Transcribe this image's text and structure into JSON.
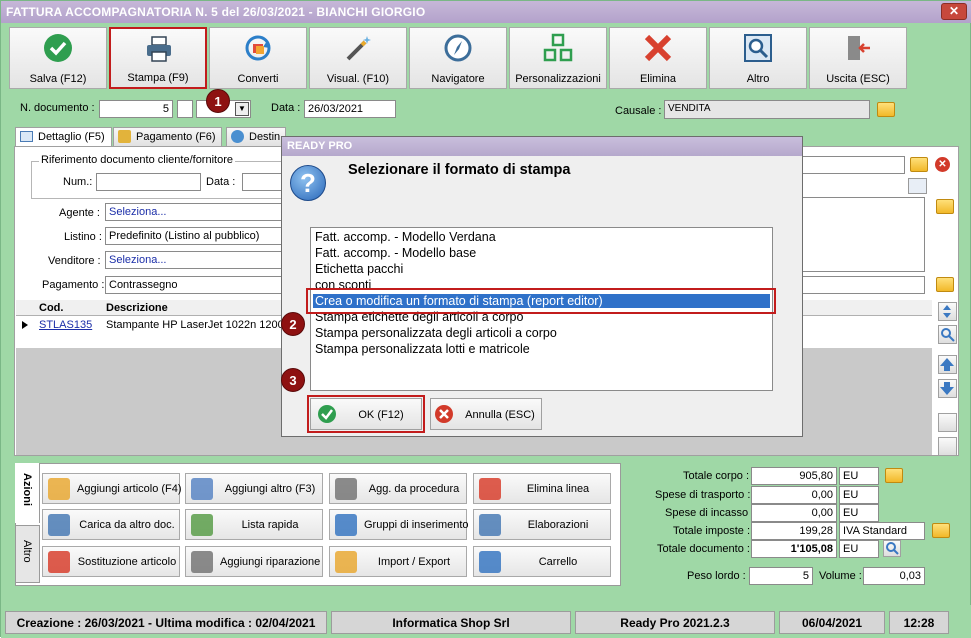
{
  "window": {
    "title": "FATTURA ACCOMPAGNATORIA N. 5 del 26/03/2021 - BIANCHI GIORGIO",
    "close_glyph": "✕"
  },
  "toolbar": [
    {
      "label": "Salva (F12)",
      "icon": "check-icon"
    },
    {
      "label": "Stampa (F9)",
      "icon": "printer-icon"
    },
    {
      "label": "Converti",
      "icon": "convert-icon"
    },
    {
      "label": "Visual. (F10)",
      "icon": "magic-wand-icon"
    },
    {
      "label": "Navigatore",
      "icon": "compass-icon"
    },
    {
      "label": "Personalizzazioni",
      "icon": "grid-icon"
    },
    {
      "label": "Elimina",
      "icon": "delete-x-icon"
    },
    {
      "label": "Altro",
      "icon": "magnifier-icon"
    },
    {
      "label": "Uscita (ESC)",
      "icon": "exit-door-icon"
    }
  ],
  "header": {
    "doc_label": "N. documento :",
    "doc_value": "5",
    "date_label": "Data :",
    "date_value": "26/03/2021",
    "causale_label": "Causale :",
    "causale_value": "VENDITA"
  },
  "tabs": [
    {
      "label": "Dettaglio (F5)"
    },
    {
      "label": "Pagamento (F6)"
    },
    {
      "label": "Destin"
    }
  ],
  "detail": {
    "rif_title": "Riferimento documento cliente/fornitore",
    "num_label": "Num.:",
    "data_label": "Data :",
    "agente_label": "Agente :",
    "agente_value": "Seleziona...",
    "listino_label": "Listino :",
    "listino_value": "Predefinito (Listino al pubblico)",
    "venditore_label": "Venditore :",
    "venditore_value": "Seleziona...",
    "pagamento_label": "Pagamento :",
    "pagamento_value": "Contrassegno"
  },
  "grid": {
    "col_cod": "Cod.",
    "col_desc": "Descrizione",
    "rows": [
      {
        "cod": "STLAS135",
        "desc": "Stampante HP LaserJet 1022n 1200x"
      }
    ]
  },
  "side_tabs": {
    "azioni": "Azioni",
    "altro": "Altro"
  },
  "actions": [
    {
      "label": "Aggiungi articolo (F4)"
    },
    {
      "label": "Aggiungi altro (F3)"
    },
    {
      "label": "Agg. da procedura"
    },
    {
      "label": "Elimina linea"
    },
    {
      "label": "Carica da altro doc."
    },
    {
      "label": "Lista rapida"
    },
    {
      "label": "Gruppi di inserimento"
    },
    {
      "label": "Elaborazioni"
    },
    {
      "label": "Sostituzione articolo"
    },
    {
      "label": "Aggiungi riparazione"
    },
    {
      "label": "Import / Export"
    },
    {
      "label": "Carrello"
    }
  ],
  "totals": {
    "corpo_label": "Totale corpo :",
    "corpo_value": "905,80",
    "corpo_cur": "EU",
    "trasporto_label": "Spese di trasporto :",
    "trasporto_value": "0,00",
    "trasporto_cur": "EU",
    "incasso_label": "Spese di incasso :",
    "incasso_value": "0,00",
    "incasso_cur": "EU",
    "imposte_label": "Totale imposte :",
    "imposte_value": "199,28",
    "imposte_cur": "IVA Standard",
    "documento_label": "Totale documento :",
    "documento_value": "1'105,08",
    "documento_cur": "EU",
    "peso_label": "Peso lordo :",
    "peso_value": "5",
    "volume_label": "Volume :",
    "volume_value": "0,03"
  },
  "status": {
    "created": "Creazione : 26/03/2021 - Ultima modifica : 02/04/2021",
    "company": "Informatica Shop Srl",
    "version": "Ready Pro 2021.2.3",
    "date": "06/04/2021",
    "time": "12:28"
  },
  "dialog": {
    "title": "READY PRO",
    "question_glyph": "?",
    "heading": "Selezionare il formato di stampa",
    "items": [
      "Fatt. accomp. - Modello Verdana",
      "Fatt. accomp. - Modello base",
      "Etichetta pacchi",
      "con sconti",
      "Crea o modifica un formato di stampa (report editor)",
      "Stampa etichette degli articoli a corpo",
      "Stampa personalizzata degli articoli a corpo",
      "Stampa personalizzata lotti e matricole"
    ],
    "selected_index": 4,
    "ok_label": "OK (F12)",
    "cancel_label": "Annulla (ESC)"
  },
  "badges": [
    "1",
    "2",
    "3"
  ],
  "colors": {
    "window_bg": "#9fd8a6",
    "selection": "#2f71c9",
    "highlight_red": "#c21c1c",
    "badge": "#8e1111"
  }
}
